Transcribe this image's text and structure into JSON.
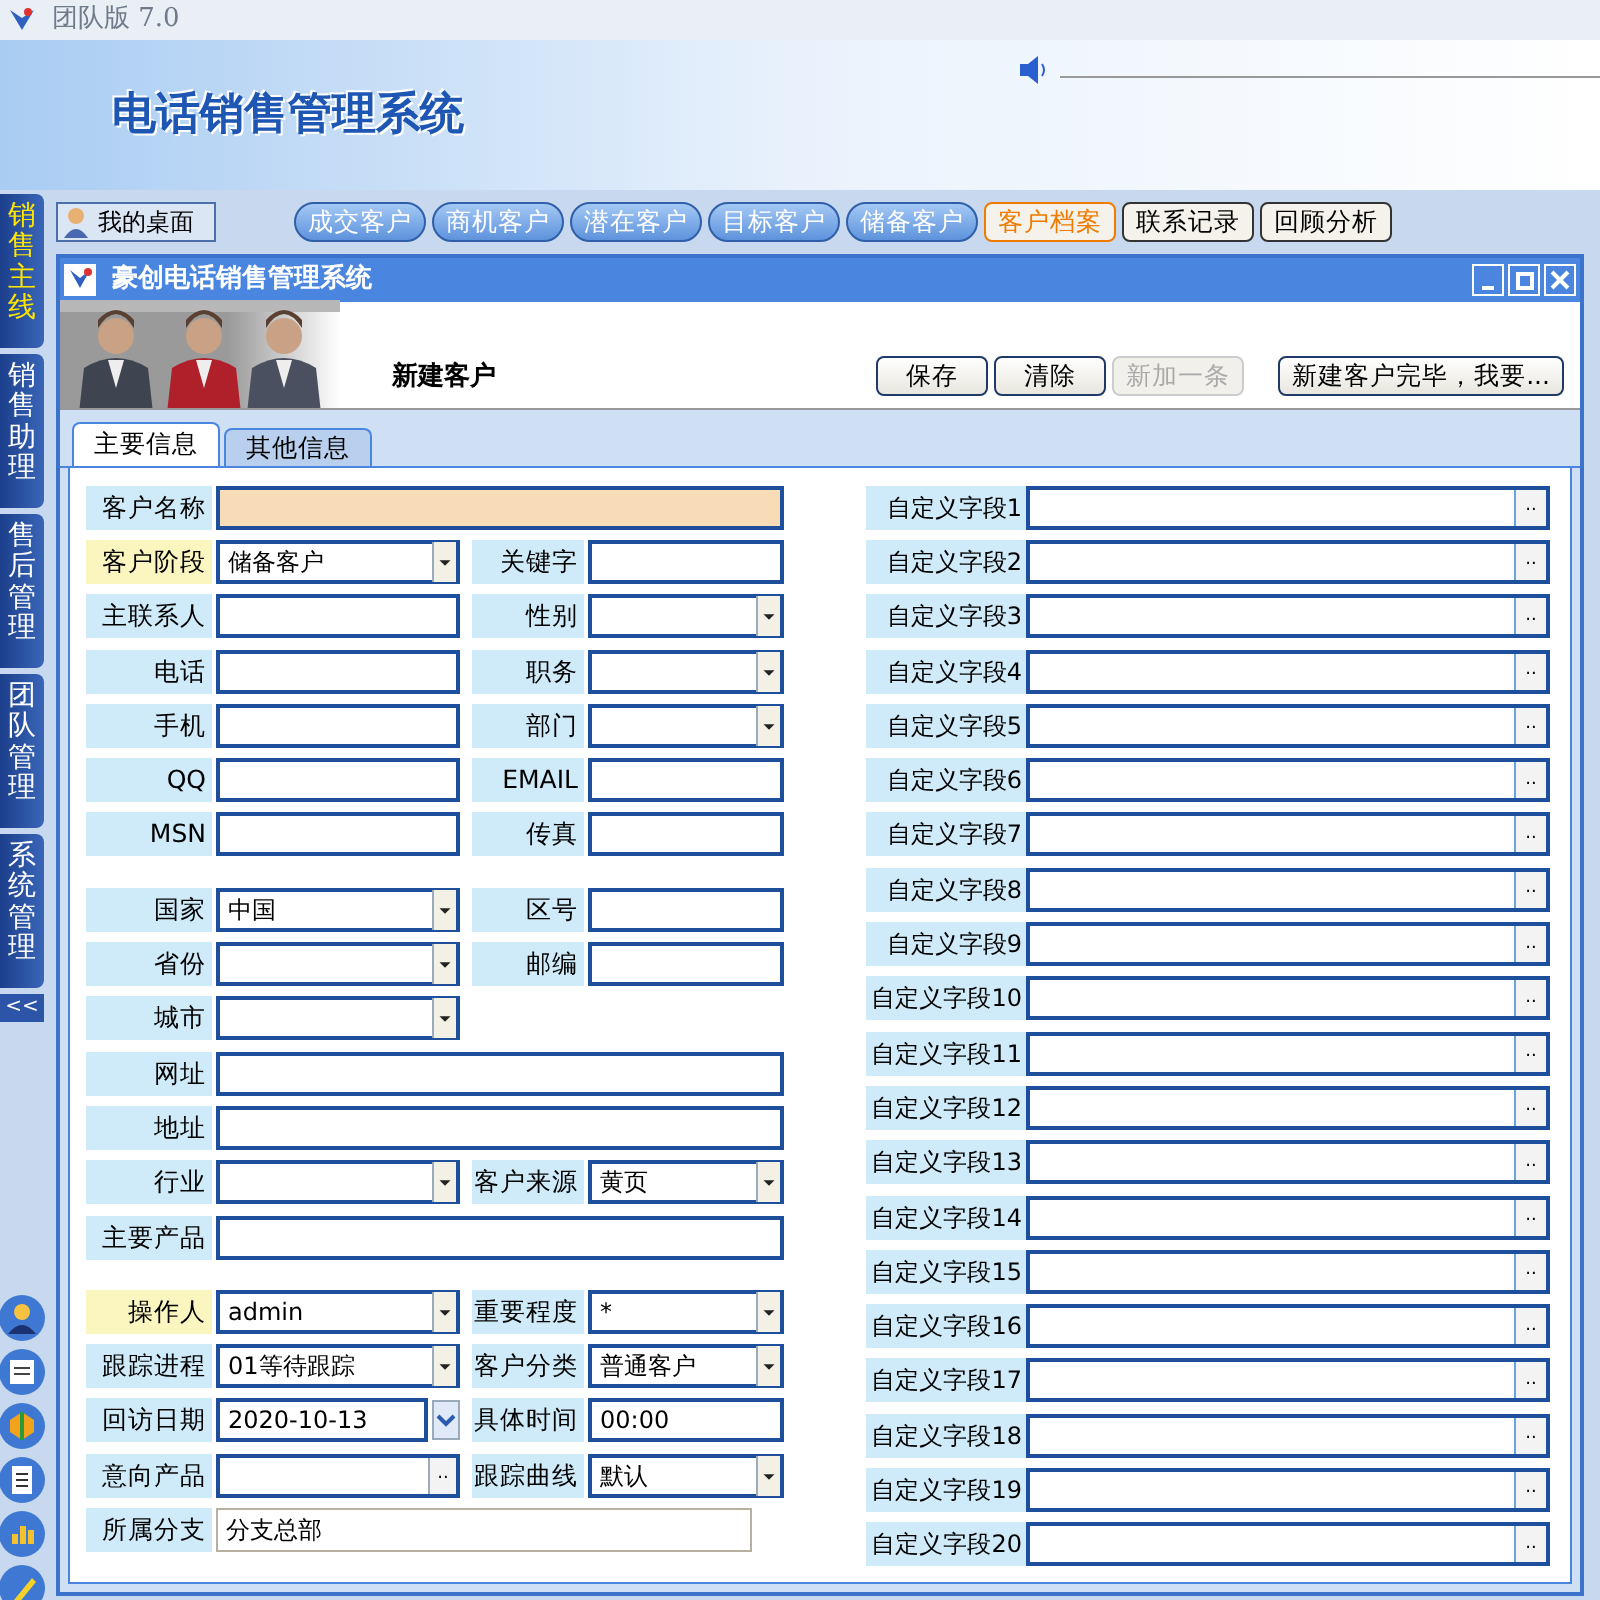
{
  "app": {
    "title": "团队版 7.0",
    "banner_title": "电话销售管理系统"
  },
  "sidebar": {
    "tabs": [
      {
        "label": "销售主线",
        "selected": true
      },
      {
        "label": "销售助理",
        "selected": false
      },
      {
        "label": "售后管理",
        "selected": false
      },
      {
        "label": "团队管理",
        "selected": false
      },
      {
        "label": "系统管理",
        "selected": false
      }
    ],
    "collapse": "<<"
  },
  "desktop": "我的桌面",
  "nav_tabs": [
    {
      "label": "成交客户",
      "kind": "pill",
      "selected": false
    },
    {
      "label": "商机客户",
      "kind": "pill",
      "selected": false
    },
    {
      "label": "潜在客户",
      "kind": "pill",
      "selected": false
    },
    {
      "label": "目标客户",
      "kind": "pill",
      "selected": false
    },
    {
      "label": "储备客户",
      "kind": "pill",
      "selected": false
    },
    {
      "label": "客户档案",
      "kind": "plain",
      "selected": true
    },
    {
      "label": "联系记录",
      "kind": "plain",
      "selected": false
    },
    {
      "label": "回顾分析",
      "kind": "plain",
      "selected": false
    }
  ],
  "window": {
    "title": "豪创电话销售管理系统",
    "heading": "新建客户",
    "buttons": [
      {
        "label": "保存",
        "disabled": false
      },
      {
        "label": "清除",
        "disabled": false
      },
      {
        "label": "新加一条",
        "disabled": true
      },
      {
        "label": "新建客户完毕，我要...",
        "disabled": false
      }
    ],
    "tabs": [
      {
        "label": "主要信息",
        "selected": true
      },
      {
        "label": "其他信息",
        "selected": false
      }
    ]
  },
  "form": {
    "groups": [
      [
        {
          "fields": [
            {
              "label": "客户名称",
              "kind": "text",
              "wide": true,
              "required": false,
              "emphasized": true
            }
          ]
        },
        {
          "fields": [
            {
              "label": "客户阶段",
              "kind": "dropdown",
              "value": "储备客户",
              "wide": false,
              "required": true,
              "emphasized": false
            },
            {
              "label": "关键字",
              "kind": "text",
              "wide": false,
              "required": false,
              "emphasized": false
            }
          ]
        },
        {
          "fields": [
            {
              "label": "主联系人",
              "kind": "text",
              "wide": false,
              "required": false,
              "emphasized": false
            },
            {
              "label": "性别",
              "kind": "dropdown",
              "wide": false,
              "required": false,
              "emphasized": false
            }
          ]
        },
        {
          "fields": [
            {
              "label": "电话",
              "kind": "text",
              "wide": false,
              "required": false,
              "emphasized": false
            },
            {
              "label": "职务",
              "kind": "dropdown",
              "wide": false,
              "required": false,
              "emphasized": false
            }
          ]
        },
        {
          "fields": [
            {
              "label": "手机",
              "kind": "text",
              "wide": false,
              "required": false,
              "emphasized": false
            },
            {
              "label": "部门",
              "kind": "dropdown",
              "wide": false,
              "required": false,
              "emphasized": false
            }
          ]
        },
        {
          "fields": [
            {
              "label": "QQ",
              "kind": "text",
              "wide": false,
              "required": false,
              "emphasized": false
            },
            {
              "label": "EMAIL",
              "kind": "text",
              "wide": false,
              "required": false,
              "emphasized": false
            }
          ]
        },
        {
          "fields": [
            {
              "label": "MSN",
              "kind": "text",
              "wide": false,
              "required": false,
              "emphasized": false
            },
            {
              "label": "传真",
              "kind": "text",
              "wide": false,
              "required": false,
              "emphasized": false
            }
          ]
        }
      ],
      [
        {
          "fields": [
            {
              "label": "国家",
              "kind": "dropdown",
              "value": "中国",
              "wide": false,
              "required": false,
              "emphasized": false
            },
            {
              "label": "区号",
              "kind": "text",
              "wide": false,
              "required": false,
              "emphasized": false
            }
          ]
        },
        {
          "fields": [
            {
              "label": "省份",
              "kind": "dropdown",
              "wide": false,
              "required": false,
              "emphasized": false
            },
            {
              "label": "邮编",
              "kind": "text",
              "wide": false,
              "required": false,
              "emphasized": false
            }
          ]
        },
        {
          "fields": [
            {
              "label": "城市",
              "kind": "dropdown",
              "wide": false,
              "required": false,
              "emphasized": false
            }
          ]
        },
        {
          "fields": [
            {
              "label": "网址",
              "kind": "text",
              "wide": true,
              "required": false,
              "emphasized": false
            }
          ]
        },
        {
          "fields": [
            {
              "label": "地址",
              "kind": "text",
              "wide": true,
              "required": false,
              "emphasized": false
            }
          ]
        },
        {
          "fields": [
            {
              "label": "行业",
              "kind": "dropdown",
              "wide": false,
              "required": false,
              "emphasized": false
            },
            {
              "label": "客户来源",
              "kind": "dropdown",
              "value": "黄页",
              "wide": false,
              "required": false,
              "emphasized": false
            }
          ]
        },
        {
          "fields": [
            {
              "label": "主要产品",
              "kind": "text",
              "wide": true,
              "required": false,
              "emphasized": false
            }
          ]
        }
      ],
      [
        {
          "fields": [
            {
              "label": "操作人",
              "kind": "dropdown",
              "value": "admin",
              "wide": false,
              "required": true,
              "emphasized": false
            },
            {
              "label": "重要程度",
              "kind": "dropdown",
              "value": "*",
              "wide": false,
              "required": false,
              "emphasized": false
            }
          ]
        },
        {
          "fields": [
            {
              "label": "跟踪进程",
              "kind": "dropdown",
              "value": "01等待跟踪",
              "wide": false,
              "required": false,
              "emphasized": false
            },
            {
              "label": "客户分类",
              "kind": "dropdown",
              "value": "普通客户",
              "wide": false,
              "required": false,
              "emphasized": false
            }
          ]
        },
        {
          "fields": [
            {
              "label": "回访日期",
              "kind": "date",
              "value": "2020-10-13",
              "wide": false,
              "required": false,
              "emphasized": false
            },
            {
              "label": "具体时间",
              "kind": "text",
              "value": "00:00",
              "wide": false,
              "required": false,
              "emphasized": false
            }
          ]
        },
        {
          "fields": [
            {
              "label": "意向产品",
              "kind": "browse",
              "button": "..",
              "wide": false,
              "required": false,
              "emphasized": false
            },
            {
              "label": "跟踪曲线",
              "kind": "dropdown",
              "value": "默认",
              "wide": false,
              "required": false,
              "emphasized": false
            }
          ]
        },
        {
          "fields": [
            {
              "label": "所属分支",
              "kind": "readonly",
              "value": "分支总部",
              "wide": true,
              "required": false,
              "emphasized": false
            }
          ]
        }
      ]
    ],
    "custom_fields": [
      {
        "label": "自定义字段1",
        "button": ".."
      },
      {
        "label": "自定义字段2",
        "button": ".."
      },
      {
        "label": "自定义字段3",
        "button": ".."
      },
      {
        "label": "自定义字段4",
        "button": ".."
      },
      {
        "label": "自定义字段5",
        "button": ".."
      },
      {
        "label": "自定义字段6",
        "button": ".."
      },
      {
        "label": "自定义字段7",
        "button": ".."
      },
      {
        "label": "自定义字段8",
        "button": ".."
      },
      {
        "label": "自定义字段9",
        "button": ".."
      },
      {
        "label": "自定义字段10",
        "button": ".."
      },
      {
        "label": "自定义字段11",
        "button": ".."
      },
      {
        "label": "自定义字段12",
        "button": ".."
      },
      {
        "label": "自定义字段13",
        "button": ".."
      },
      {
        "label": "自定义字段14",
        "button": ".."
      },
      {
        "label": "自定义字段15",
        "button": ".."
      },
      {
        "label": "自定义字段16",
        "button": ".."
      },
      {
        "label": "自定义字段17",
        "button": ".."
      },
      {
        "label": "自定义字段18",
        "button": ".."
      },
      {
        "label": "自定义字段19",
        "button": ".."
      },
      {
        "label": "自定义字段20",
        "button": ".."
      }
    ]
  }
}
